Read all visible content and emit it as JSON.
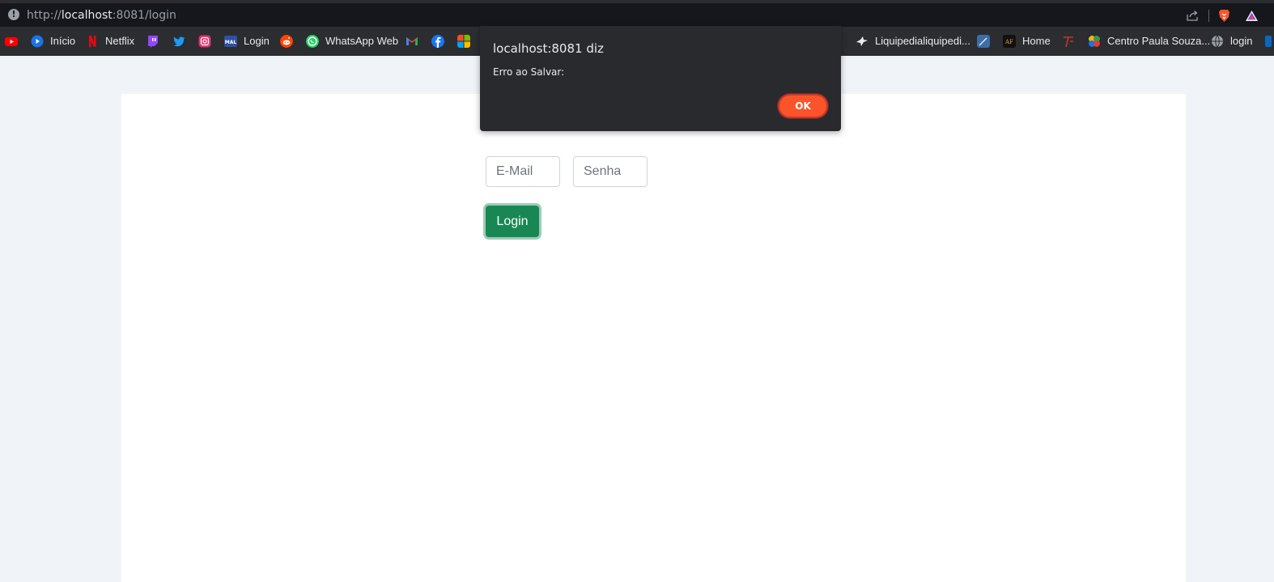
{
  "browser": {
    "url_scheme": "http://",
    "url_host": "localhost",
    "url_rest": ":8081/login"
  },
  "bookmarks": [
    {
      "id": "youtube",
      "label": "",
      "icon": "youtube-icon",
      "color": "#ff0000"
    },
    {
      "id": "inicio",
      "label": "Início",
      "icon": "play-circle-icon",
      "color": "#1a73e8"
    },
    {
      "id": "netflix",
      "label": "Netflix",
      "icon": "netflix-icon",
      "color": "#e50914"
    },
    {
      "id": "twitch",
      "label": "",
      "icon": "twitch-icon",
      "color": "#9146ff"
    },
    {
      "id": "twitter",
      "label": "",
      "icon": "twitter-icon",
      "color": "#1d9bf0"
    },
    {
      "id": "instagram",
      "label": "",
      "icon": "instagram-icon",
      "color": "#e1306c"
    },
    {
      "id": "mal",
      "label": "Login",
      "icon": "mal-icon",
      "color": "#2e51a2"
    },
    {
      "id": "reddit",
      "label": "",
      "icon": "reddit-icon",
      "color": "#ff4500"
    },
    {
      "id": "whatsapp",
      "label": "WhatsApp Web",
      "icon": "whatsapp-icon",
      "color": "#25d366"
    },
    {
      "id": "gmail",
      "label": "",
      "icon": "gmail-icon",
      "color": "#ea4335"
    },
    {
      "id": "facebook",
      "label": "",
      "icon": "facebook-icon",
      "color": "#1877f2"
    },
    {
      "id": "microsoft",
      "label": "",
      "icon": "microsoft-icon",
      "color": "#f25022"
    },
    {
      "id": "trunc",
      "label": "..",
      "icon": "",
      "color": ""
    },
    {
      "id": "liquipedia",
      "label": "Liquipedialiquipedi...",
      "icon": "liquipedia-icon",
      "color": "#ffffff"
    },
    {
      "id": "pencil",
      "label": "",
      "icon": "pencil-app-icon",
      "color": "#3b6ea5"
    },
    {
      "id": "home",
      "label": "Home",
      "icon": "home-site-icon",
      "color": "#111111"
    },
    {
      "id": "tf",
      "label": "",
      "icon": "tf-icon",
      "color": "#c0392b"
    },
    {
      "id": "cps",
      "label": "Centro Paula Souza...",
      "icon": "cps-icon",
      "color": "#f2b705"
    },
    {
      "id": "globe",
      "label": "login",
      "icon": "globe-icon",
      "color": "#9aa0a6"
    }
  ],
  "form": {
    "email_placeholder": "E-Mail",
    "senha_placeholder": "Senha",
    "email_value": "",
    "senha_value": "",
    "login_label": "Login"
  },
  "alert": {
    "title": "localhost:8081 diz",
    "message": "Erro ao Salvar:",
    "ok_label": "OK"
  },
  "colors": {
    "accent_ok": "#fb542b",
    "login_button": "#198754"
  }
}
